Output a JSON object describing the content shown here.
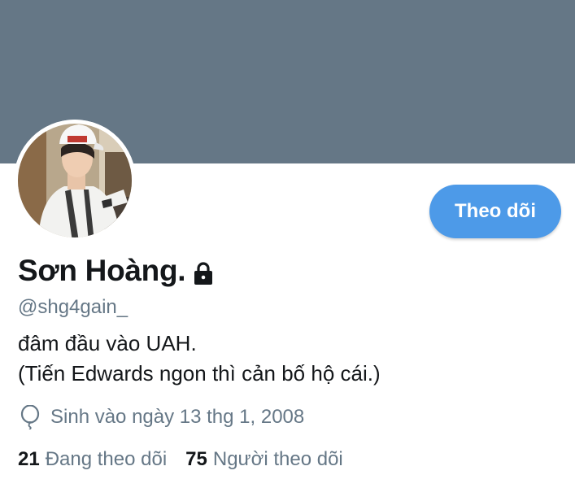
{
  "profile": {
    "display_name": "Sơn Hoàng.",
    "handle": "@shg4gain_",
    "bio_lines": [
      "đâm đầu vào UAH.",
      "(Tiến Edwards ngon thì cản bố hộ cái.)"
    ],
    "birth_text": "Sinh vào ngày 13 thg 1, 2008",
    "protected_icon": "lock-icon",
    "birth_icon": "balloon-icon"
  },
  "actions": {
    "follow_label": "Theo dõi"
  },
  "stats": {
    "following_count": "21",
    "following_label": "Đang theo dõi",
    "followers_count": "75",
    "followers_label": "Người theo dõi"
  },
  "colors": {
    "banner": "#657786",
    "accent": "#4d9ae8",
    "text_primary": "#14171a",
    "text_secondary": "#657786"
  }
}
